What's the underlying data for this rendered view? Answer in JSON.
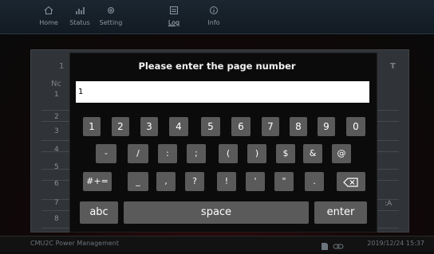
{
  "nav": {
    "items": [
      {
        "label": "Home",
        "icon": "home-icon"
      },
      {
        "label": "Status",
        "icon": "status-icon"
      },
      {
        "label": "Setting",
        "icon": "gear-icon"
      },
      {
        "label": "Log",
        "icon": "log-icon"
      },
      {
        "label": "Info",
        "icon": "info-icon"
      }
    ],
    "active": "Log"
  },
  "background_table": {
    "header_fragment_left": "1",
    "header_fragment_right": "T",
    "col_fragment": "Nc",
    "row_numbers": [
      "1",
      "2",
      "3",
      "4",
      "5",
      "6",
      "7",
      "8"
    ],
    "right_fragment": ":A"
  },
  "dialog": {
    "title": "Please enter the page number",
    "input_value": "1",
    "keys_row1": [
      "1",
      "2",
      "3",
      "4",
      "5",
      "6",
      "7",
      "8",
      "9",
      "0"
    ],
    "keys_row2": [
      "-",
      "/",
      ":",
      ";",
      "(",
      ")",
      "$",
      "&",
      "@"
    ],
    "keys_row3": [
      "#+=",
      "_",
      ",",
      "?",
      "!",
      "'",
      "\"",
      "."
    ],
    "key_abc": "abc",
    "key_space": "space",
    "key_enter": "enter"
  },
  "statusbar": {
    "left": "CMU2C Power Management",
    "right": "2019/12/24 15:37"
  },
  "colors": {
    "key_bg": "#5a5a5a",
    "dialog_bg": "#0b0b0b",
    "input_bg": "#ffffff"
  }
}
